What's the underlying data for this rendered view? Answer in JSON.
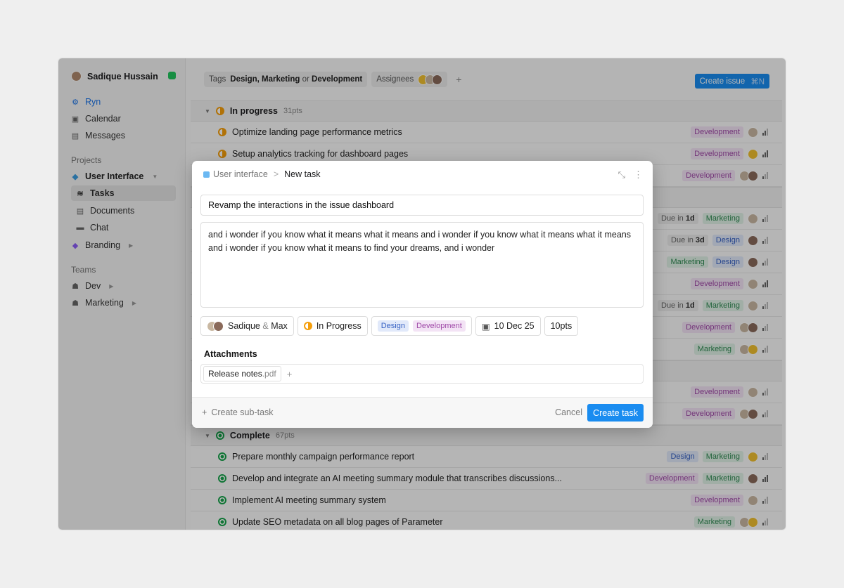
{
  "sidebar": {
    "user_name": "Sadique Hussain",
    "workspace": "Ryn",
    "calendar": "Calendar",
    "messages": "Messages",
    "projects_label": "Projects",
    "project_ui": "User Interface",
    "tasks": "Tasks",
    "documents": "Documents",
    "chat": "Chat",
    "branding": "Branding",
    "teams_label": "Teams",
    "team_dev": "Dev",
    "team_marketing": "Marketing"
  },
  "filters": {
    "tags_label": "Tags",
    "tag1": "Design,",
    "tag2": "Marketing",
    "or": "or",
    "tag3": "Development",
    "assignees_label": "Assignees",
    "add": "+"
  },
  "create_issue": {
    "label": "Create issue",
    "shortcut": "⌘N"
  },
  "groups": {
    "in_progress": {
      "name": "In progress",
      "pts": "31pts"
    },
    "complete": {
      "name": "Complete",
      "pts": "67pts"
    }
  },
  "rows": {
    "r1": {
      "title": "Optimize landing page performance metrics",
      "tag": "Development"
    },
    "r2": {
      "title": "Setup analytics tracking for dashboard pages",
      "tag": "Development"
    },
    "r3": {
      "tag": "Development"
    },
    "r4": {
      "due": "Due in",
      "due_val": "1d",
      "tag": "Marketing"
    },
    "r5": {
      "due": "Due in",
      "due_val": "3d",
      "tag": "Design"
    },
    "r6": {
      "tag1": "Marketing",
      "tag2": "Design"
    },
    "r7": {
      "tag": "Development"
    },
    "r8": {
      "due": "Due in",
      "due_val": "1d",
      "tag": "Marketing"
    },
    "r9": {
      "tag": "Development"
    },
    "r10": {
      "tag": "Marketing"
    },
    "r11": {
      "tag": "Development"
    },
    "r12": {
      "tag": "Development"
    },
    "c1": {
      "title": "Prepare monthly campaign performance report",
      "tag1": "Design",
      "tag2": "Marketing"
    },
    "c2": {
      "title": "Develop and integrate an AI meeting summary module that transcribes discussions...",
      "tag1": "Development",
      "tag2": "Marketing"
    },
    "c3": {
      "title": "Implement AI meeting summary system",
      "tag": "Development"
    },
    "c4": {
      "title": "Update SEO metadata on all blog pages of Parameter",
      "tag": "Marketing"
    }
  },
  "modal": {
    "project": "User interface",
    "breadcrumb_sep": ">",
    "page": "New task",
    "title_value": "Revamp the interactions in the issue dashboard",
    "description": "and i wonder if you know what it means what it means and i wonder if you know what it means what it means and i wonder if you know what it means to find your dreams, and i wonder",
    "assignee1": "Sadique",
    "amp": "&",
    "assignee2": "Max",
    "status": "In Progress",
    "tag1": "Design",
    "tag2": "Development",
    "date": "10 Dec 25",
    "points": "10pts",
    "attachments_label": "Attachments",
    "file_name": "Release notes",
    "file_ext": ".pdf",
    "add": "+",
    "create_subtask": "Create sub-task",
    "cancel": "Cancel",
    "submit": "Create task"
  },
  "colors": {
    "accent": "#1a8cf0",
    "status_online": "#22c55e",
    "in_progress": "#f59e0b",
    "complete": "#16a34a"
  }
}
